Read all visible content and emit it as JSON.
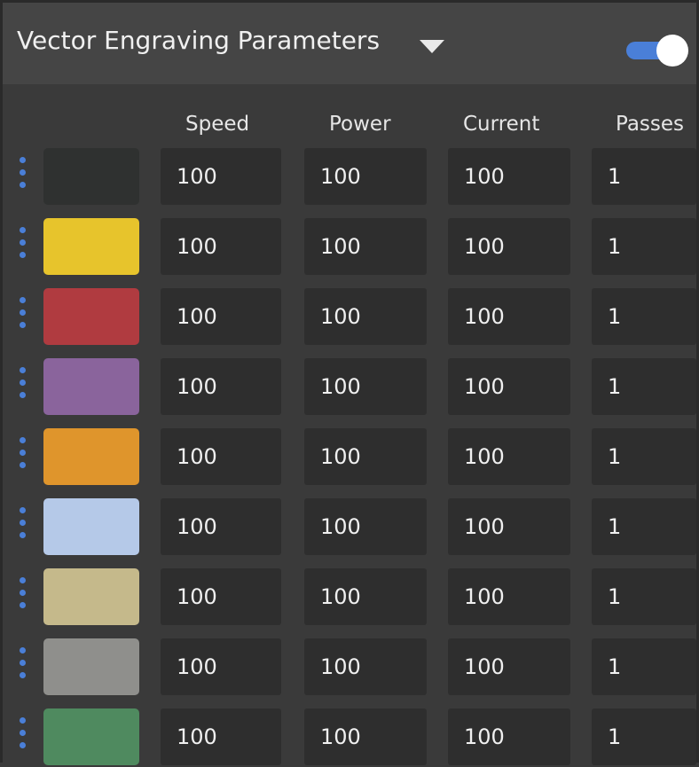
{
  "panel": {
    "title": "Vector Engraving Parameters",
    "dropdown_icon": "caret-down-icon",
    "toggle_on": true,
    "accent_color": "#4a7fd8"
  },
  "columns": {
    "speed": "Speed",
    "power": "Power",
    "current": "Current",
    "passes": "Passes"
  },
  "rows": [
    {
      "color": "#2f3130",
      "speed": "100",
      "power": "100",
      "current": "100",
      "passes": "1"
    },
    {
      "color": "#e7c42c",
      "speed": "100",
      "power": "100",
      "current": "100",
      "passes": "1"
    },
    {
      "color": "#b03b40",
      "speed": "100",
      "power": "100",
      "current": "100",
      "passes": "1"
    },
    {
      "color": "#8a649c",
      "speed": "100",
      "power": "100",
      "current": "100",
      "passes": "1"
    },
    {
      "color": "#df952c",
      "speed": "100",
      "power": "100",
      "current": "100",
      "passes": "1"
    },
    {
      "color": "#b5c9e8",
      "speed": "100",
      "power": "100",
      "current": "100",
      "passes": "1"
    },
    {
      "color": "#c5b98b",
      "speed": "100",
      "power": "100",
      "current": "100",
      "passes": "1"
    },
    {
      "color": "#8f8f8c",
      "speed": "100",
      "power": "100",
      "current": "100",
      "passes": "1"
    },
    {
      "color": "#4f8a5f",
      "speed": "100",
      "power": "100",
      "current": "100",
      "passes": "1"
    }
  ]
}
